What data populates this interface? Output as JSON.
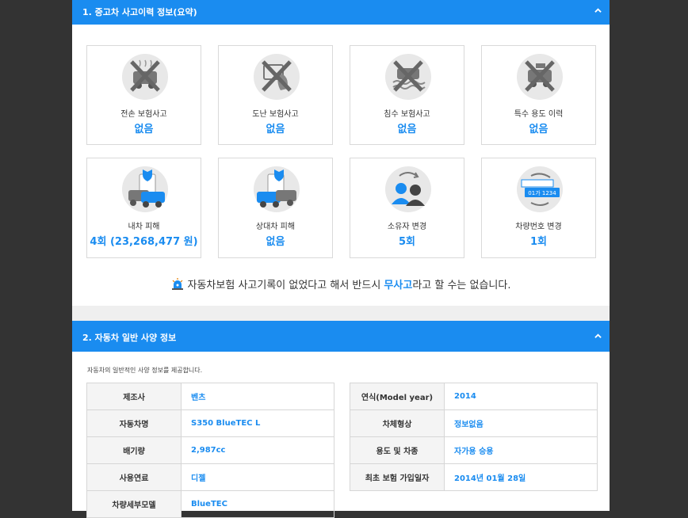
{
  "section1": {
    "title": "1. 중고차 사고이력 정보(요약)",
    "cards": [
      {
        "label": "전손 보험사고",
        "value": "없음",
        "icon": "total-loss-icon"
      },
      {
        "label": "도난 보험사고",
        "value": "없음",
        "icon": "theft-icon"
      },
      {
        "label": "침수 보험사고",
        "value": "없음",
        "icon": "flood-icon"
      },
      {
        "label": "특수 용도 이력",
        "value": "없음",
        "icon": "special-use-icon"
      },
      {
        "label": "내차 피해",
        "value": "4회 (23,268,477 원)",
        "icon": "my-car-damage-icon"
      },
      {
        "label": "상대차 피해",
        "value": "없음",
        "icon": "other-car-damage-icon"
      },
      {
        "label": "소유자 변경",
        "value": "5회",
        "icon": "owner-change-icon"
      },
      {
        "label": "차량번호 변경",
        "value": "1회",
        "icon": "plate-change-icon"
      }
    ],
    "plate_text": "01가 1234",
    "notice_prefix": "자동차보험 사고기록이 없었다고 해서 반드시 ",
    "notice_highlight": "무사고",
    "notice_suffix": "라고 할 수는 없습니다."
  },
  "section2": {
    "title": "2. 자동차 일반 사양 정보",
    "description": "자동차의 일반적인 사양 정보를 제공합니다.",
    "left_table": [
      {
        "key": "제조사",
        "value": "벤츠"
      },
      {
        "key": "자동차명",
        "value": "S350 BlueTEC L"
      },
      {
        "key": "배기량",
        "value": "2,987cc"
      },
      {
        "key": "사용연료",
        "value": "디젤"
      },
      {
        "key": "차량세부모델",
        "value": "BlueTEC"
      }
    ],
    "right_table": [
      {
        "key": "연식(Model year)",
        "value": "2014"
      },
      {
        "key": "차체형상",
        "value": "정보없음"
      },
      {
        "key": "용도 및 차종",
        "value": "자가용  승용"
      },
      {
        "key": "최초 보험 가입일자",
        "value": "2014년 01월 28일"
      }
    ]
  },
  "colors": {
    "accent": "#1a8cf0",
    "outer_bg": "#333333",
    "card_border": "#d9d9d9"
  }
}
